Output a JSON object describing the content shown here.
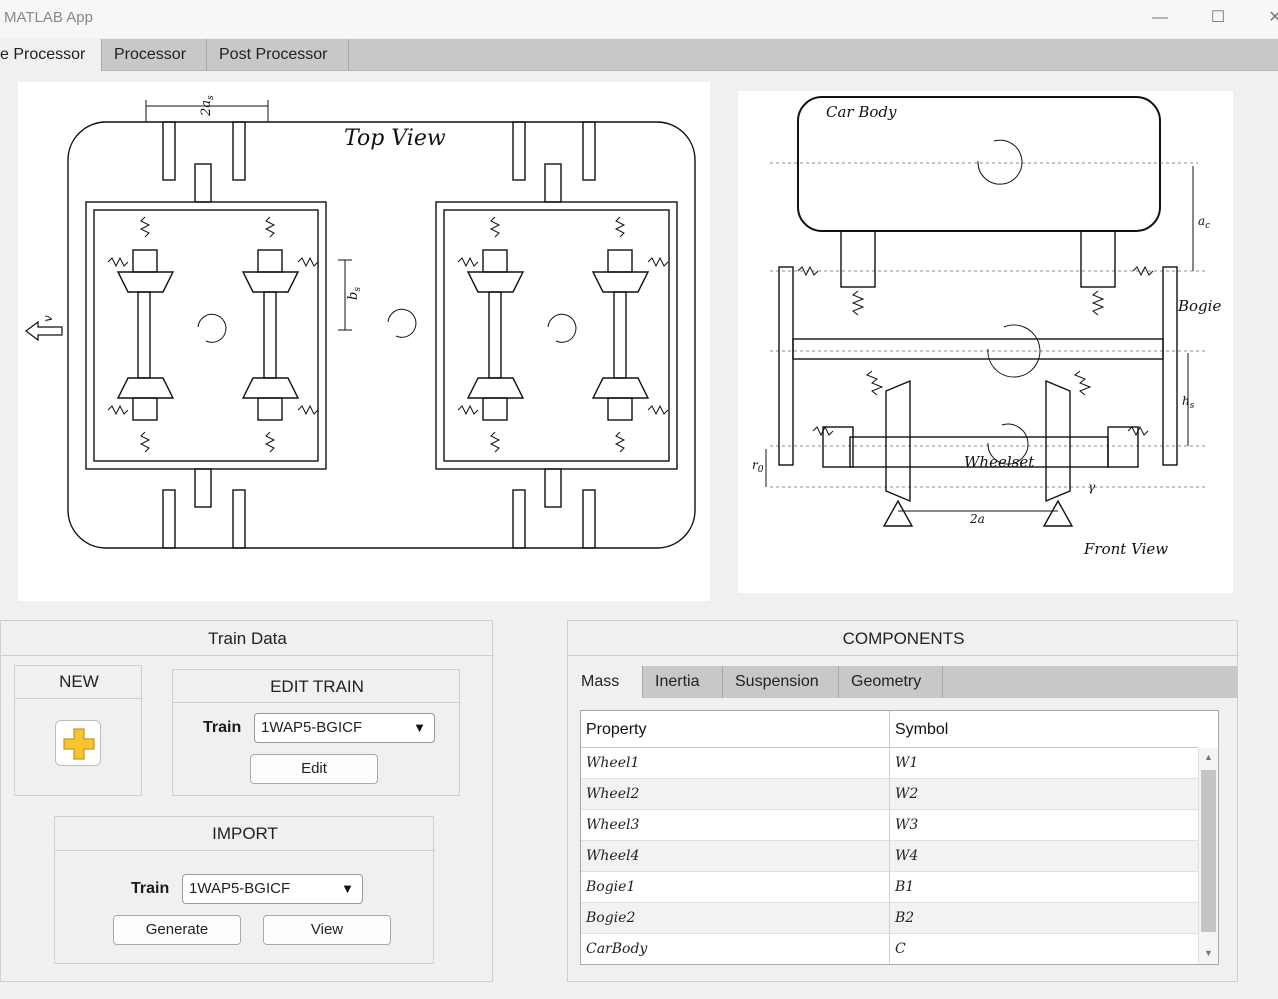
{
  "window": {
    "title": "MATLAB App"
  },
  "main_tabs": [
    {
      "label": "e Processor"
    },
    {
      "label": "Processor"
    },
    {
      "label": "Post Processor"
    }
  ],
  "top_view": {
    "title": "Top View",
    "dim_2as": "2a",
    "dim_2as_sub": "s",
    "label_bs": "b",
    "label_bs_sub": "s",
    "velocity": "v"
  },
  "front_view": {
    "car_body": "Car Body",
    "bogie": "Bogie",
    "wheelset": "Wheelset",
    "title": "Front View",
    "dim_2a": "2a",
    "a_c": "a",
    "a_c_sub": "c",
    "h_s": "h",
    "h_s_sub": "s",
    "r_0": "r",
    "r_0_sub": "0",
    "gamma": "γ"
  },
  "train_data": {
    "title": "Train Data",
    "new": {
      "title": "NEW"
    },
    "edit": {
      "title": "EDIT TRAIN",
      "train_label": "Train",
      "train_value": "1WAP5-BGICF",
      "edit_button": "Edit"
    },
    "import": {
      "title": "IMPORT",
      "train_label": "Train",
      "train_value": "1WAP5-BGICF",
      "generate_button": "Generate",
      "view_button": "View"
    }
  },
  "components": {
    "title": "COMPONENTS",
    "tabs": [
      {
        "label": "Mass"
      },
      {
        "label": "Inertia"
      },
      {
        "label": "Suspension"
      },
      {
        "label": "Geometry"
      }
    ],
    "columns": {
      "property": "Property",
      "symbol": "Symbol"
    },
    "rows": [
      {
        "property": "Wheel1",
        "symbol": "W1"
      },
      {
        "property": "Wheel2",
        "symbol": "W2"
      },
      {
        "property": "Wheel3",
        "symbol": "W3"
      },
      {
        "property": "Wheel4",
        "symbol": "W4"
      },
      {
        "property": "Bogie1",
        "symbol": "B1"
      },
      {
        "property": "Bogie2",
        "symbol": "B2"
      },
      {
        "property": "CarBody",
        "symbol": "C"
      }
    ]
  },
  "colors": {
    "accent_plus": "#f7c531",
    "tab_bar": "#c8c8c8",
    "row_alt": "#f2f2f2"
  }
}
